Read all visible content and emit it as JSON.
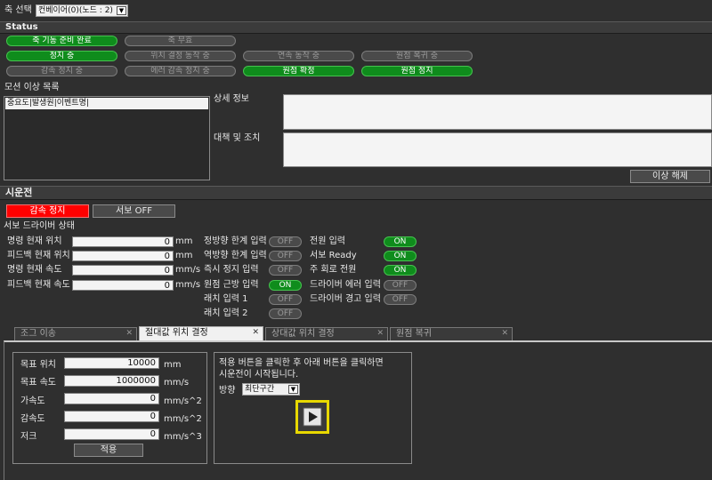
{
  "axis": {
    "label": "축 선택",
    "selected": "컨베이어(0)(노드 : 2)"
  },
  "status": {
    "title": "Status",
    "pills": [
      {
        "label": "축 기동 준비 완료",
        "on": true
      },
      {
        "label": "축 무효",
        "on": false
      },
      {
        "label": "정지 중",
        "on": true
      },
      {
        "label": "위치 결정 동작 중",
        "on": false
      },
      {
        "label": "연속 동작 중",
        "on": false
      },
      {
        "label": "원점 복귀 중",
        "on": false
      },
      {
        "label": "감속 정지 중",
        "on": false
      },
      {
        "label": "에러 감속 정지 중",
        "on": false
      },
      {
        "label": "원점 확정",
        "on": true
      },
      {
        "label": "원점 정지",
        "on": true
      }
    ]
  },
  "error_list": {
    "title": "모션 이상 목록",
    "columns": "중요도|발생원|이벤트명|",
    "detail_label": "상세 정보",
    "action_label": "대책 및 조치",
    "clear_button": "이상 해제"
  },
  "trial": {
    "title": "시운전",
    "decel_stop": "감속 정지",
    "servo_off": "서보 OFF",
    "drive_status_title": "서보 드라이버 상태",
    "readouts": [
      {
        "label": "명령 현재 위치",
        "value": "0",
        "unit": "mm"
      },
      {
        "label": "피드백 현재 위치",
        "value": "0",
        "unit": "mm"
      },
      {
        "label": "명령 현재 속도",
        "value": "0",
        "unit": "mm/s"
      },
      {
        "label": "피드백 현재 속도",
        "value": "0",
        "unit": "mm/s"
      }
    ],
    "inputs_col1": [
      {
        "label": "정방향 한계 입력",
        "state": "OFF",
        "on": false
      },
      {
        "label": "역방향 한계 입력",
        "state": "OFF",
        "on": false
      },
      {
        "label": "즉시 정지 입력",
        "state": "OFF",
        "on": false
      },
      {
        "label": "원점 근방 입력",
        "state": "ON",
        "on": true
      },
      {
        "label": "래치 입력 1",
        "state": "OFF",
        "on": false
      },
      {
        "label": "래치 입력 2",
        "state": "OFF",
        "on": false
      }
    ],
    "inputs_col2": [
      {
        "label": "전원 입력",
        "state": "ON",
        "on": true
      },
      {
        "label": "서보 Ready",
        "state": "ON",
        "on": true
      },
      {
        "label": "주 회로 전원",
        "state": "ON",
        "on": true
      },
      {
        "label": "드라이버 에러 입력",
        "state": "OFF",
        "on": false
      },
      {
        "label": "드라이버 경고 입력",
        "state": "OFF",
        "on": false
      }
    ]
  },
  "tabs": [
    {
      "label": "조그 이송",
      "active": false
    },
    {
      "label": "절대값 위치 결정",
      "active": true
    },
    {
      "label": "상대값 위치 결정",
      "active": false
    },
    {
      "label": "원점 복귀",
      "active": false
    }
  ],
  "abs_pos": {
    "params": [
      {
        "label": "목표 위치",
        "value": "10000",
        "unit": "mm"
      },
      {
        "label": "목표 속도",
        "value": "1000000",
        "unit": "mm/s"
      },
      {
        "label": "가속도",
        "value": "0",
        "unit": "mm/s^2"
      },
      {
        "label": "감속도",
        "value": "0",
        "unit": "mm/s^2"
      },
      {
        "label": "저크",
        "value": "0",
        "unit": "mm/s^3"
      }
    ],
    "apply_button": "적용",
    "hint_line1": "적용 버튼을 클릭한 후 아래 버튼을 클릭하면",
    "hint_line2": "시운전이 시작됩니다.",
    "direction_label": "방향",
    "direction_value": "최단구간"
  },
  "colors": {
    "on": "#0f8c1c",
    "off": "#4a4a4a",
    "decel_stop": "#ff0000",
    "run_button_border": "#e8d800"
  },
  "icons": {
    "run": "play-icon",
    "dropdown": "chevron-down-icon",
    "close": "close-icon"
  }
}
